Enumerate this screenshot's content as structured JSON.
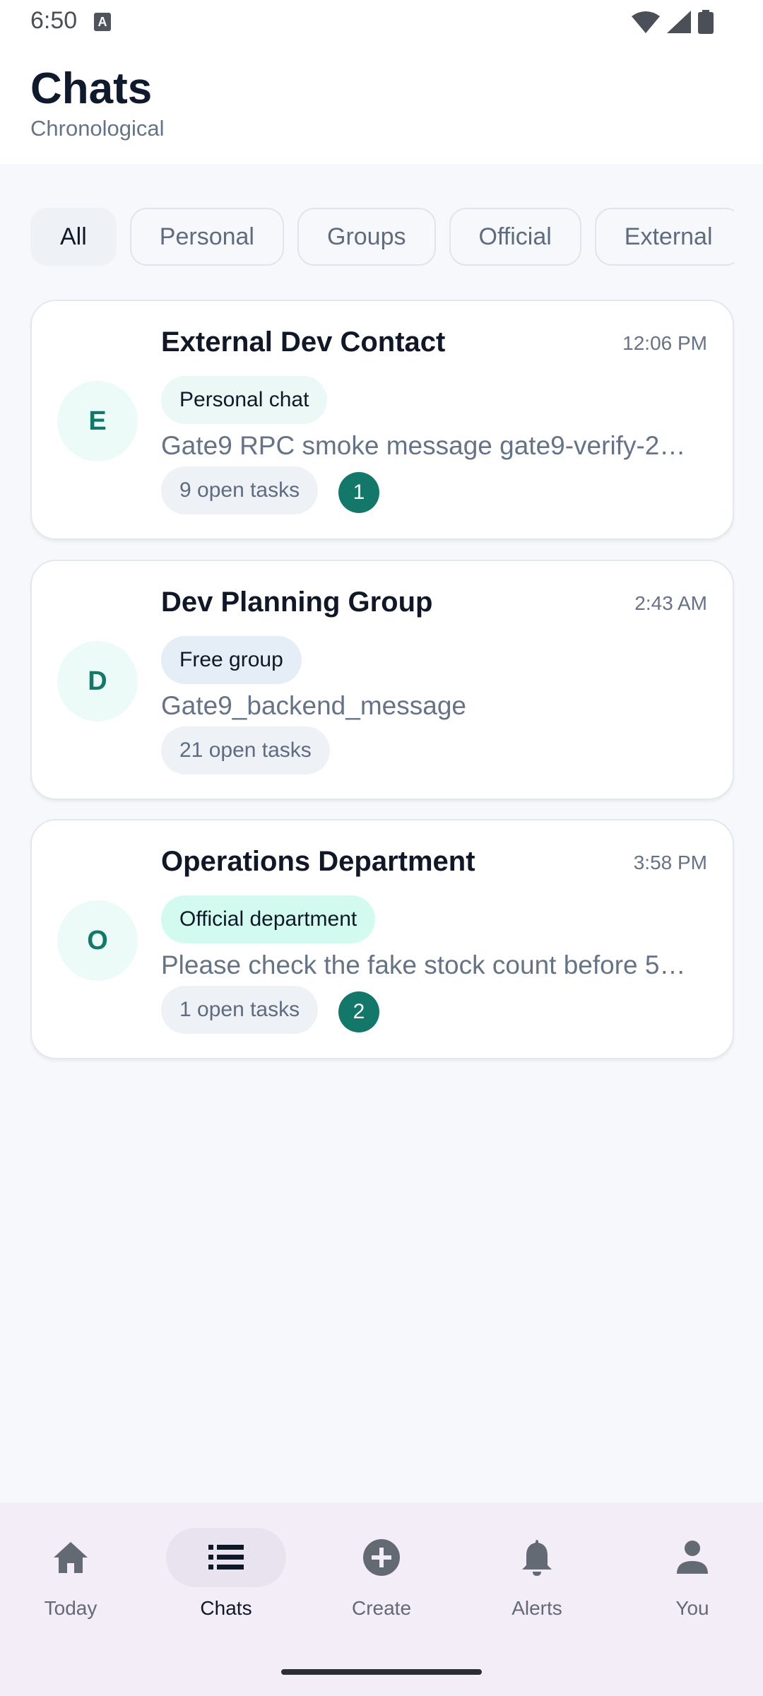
{
  "status_bar": {
    "time": "6:50",
    "notif_glyph": "A"
  },
  "header": {
    "title": "Chats",
    "subtitle": "Chronological"
  },
  "filters": [
    "All",
    "Personal",
    "Groups",
    "Official",
    "External"
  ],
  "active_filter": "All",
  "chats": [
    {
      "avatar": "E",
      "name": "External Dev Contact",
      "time": "12:06 PM",
      "tag": "Personal chat",
      "preview": "Gate9 RPC smoke message gate9-verify-2…",
      "tasks": "9 open tasks",
      "unread": "1"
    },
    {
      "avatar": "D",
      "name": "Dev Planning Group",
      "time": "2:43 AM",
      "tag": "Free group",
      "preview": "Gate9_backend_message",
      "tasks": "21 open tasks",
      "unread": ""
    },
    {
      "avatar": "O",
      "name": "Operations Department",
      "time": "3:58 PM",
      "tag": "Official department",
      "preview": "Please check the fake stock count before 5…",
      "tasks": "1 open tasks",
      "unread": "2"
    }
  ],
  "nav": [
    {
      "label": "Today",
      "icon": "home-icon"
    },
    {
      "label": "Chats",
      "icon": "list-icon"
    },
    {
      "label": "Create",
      "icon": "add-circle-icon"
    },
    {
      "label": "Alerts",
      "icon": "bell-icon"
    },
    {
      "label": "You",
      "icon": "person-icon"
    }
  ],
  "colors": {
    "accent": "#13786a",
    "nav_bg": "#f2edf6",
    "page_bg": "#f7f8fb"
  }
}
